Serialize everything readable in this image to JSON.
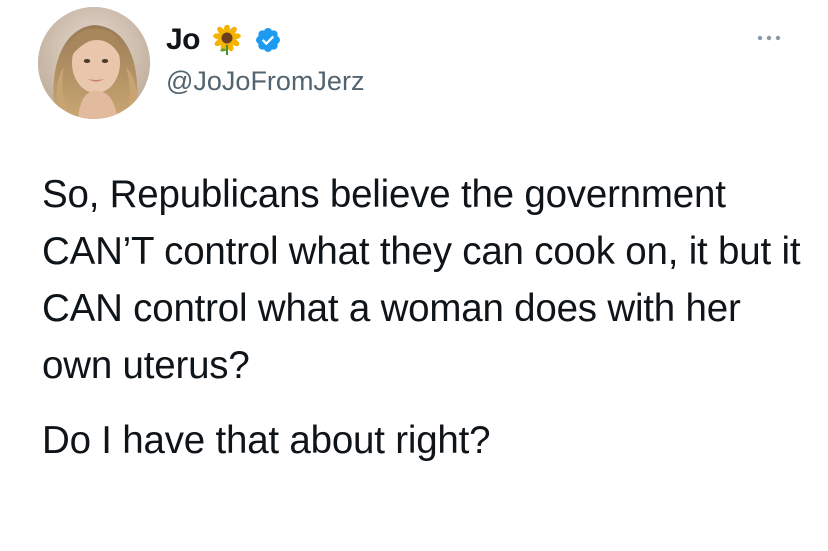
{
  "tweet": {
    "author": {
      "display_name": "Jo",
      "emoji": "sunflower-icon",
      "verified": true,
      "handle": "@JoJoFromJerz"
    },
    "more_options": "more-icon",
    "text": {
      "paragraphs": [
        "So, Republicans believe the government CAN’T control what they can cook on, it but it CAN control what a woman does with her own uterus?",
        "Do I have that about right?"
      ]
    }
  },
  "colors": {
    "text": "#0f1419",
    "secondary": "#536471",
    "verified_blue": "#1d9bf0",
    "background": "#ffffff"
  }
}
